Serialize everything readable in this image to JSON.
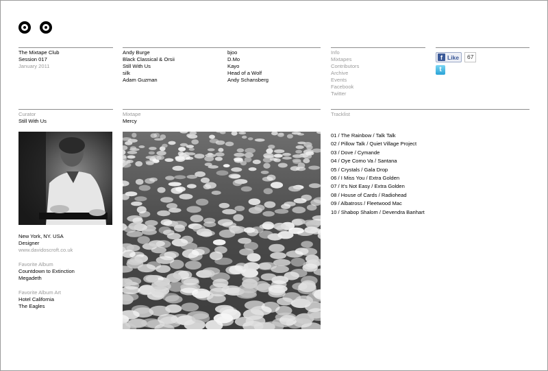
{
  "header": {
    "title": "The Mixtape Club",
    "session": "Session 017",
    "date": "January 2011"
  },
  "contributors_col1": [
    "Andy Burge",
    "Black Classical & Orsii",
    "Still With Us",
    "silk",
    "Adam Guzman"
  ],
  "contributors_col2": [
    "bjoo",
    "D.Mo",
    "Kayo",
    "Head of a Wolf",
    "Andy Schansberg"
  ],
  "nav": [
    "Info",
    "Mixtapes",
    "Contributors",
    "Archive",
    "Events",
    "Facebook",
    "Twitter"
  ],
  "social": {
    "like_label": "Like",
    "like_count": "67",
    "facebook_icon": "facebook-icon",
    "twitter_icon": "twitter-icon"
  },
  "curator": {
    "heading": "Curator",
    "name": "Still With Us",
    "location": "New York, NY. USA",
    "role": "Designer",
    "website": "www.davidoscroft.co.uk",
    "fav_album_heading": "Favorite Album",
    "fav_album_title": "Countdown to Extinction",
    "fav_album_artist": "Megadeth",
    "fav_art_heading": "Favorite Album Art",
    "fav_art_title": "Hotel California",
    "fav_art_artist": "The Eagles"
  },
  "mixtape": {
    "heading": "Mixtape",
    "name": "Mercy"
  },
  "tracklist": {
    "heading": "Tracklist",
    "tracks": [
      "01 / The Rainbow / Talk Talk",
      "02 / Pillow Talk / Quiet Village Project",
      "03 / Dove / Cymande",
      "04 / Oye Como Va / Santana",
      "05 / Crystals / Gala Drop",
      "06 / I Miss You / Extra Golden",
      "07 / It's Not Easy / Extra Golden",
      "08 / House of Cards / Radiohead",
      "09 / Albatross / Fleetwood Mac",
      "10 / Shabop Shalom / Devendra Banhart"
    ]
  },
  "colors": {
    "text": "#000000",
    "muted": "#9a9a9a",
    "rule": "#8c8c8c",
    "facebook": "#3b5998"
  }
}
